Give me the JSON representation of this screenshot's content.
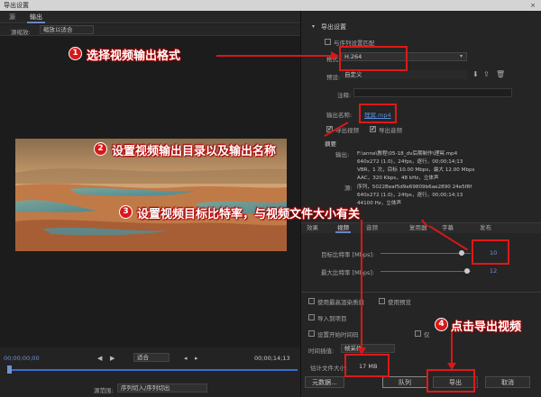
{
  "window": {
    "title": "导出设置",
    "close_glyph": "×"
  },
  "left": {
    "tabs": [
      "源",
      "输出"
    ],
    "source_scale_label": "源缩放:",
    "source_scale_value": "缩放以适合",
    "timecode_start": "00;00;00;00",
    "timecode_end": "00;00;14;13",
    "fit_value": "适合",
    "source_range_label": "源范围:",
    "source_range_value": "序列切入/序列切出"
  },
  "export": {
    "section_title": "导出设置",
    "match_sequence_label": "与序列设置匹配",
    "format_label": "格式:",
    "format_value": "H.264",
    "preset_label": "预设:",
    "preset_value": "自定义",
    "comment_label": "注释:",
    "output_name_label": "输出名称:",
    "output_name_value": "理冥.mp4",
    "export_video_label": "导出视频",
    "export_audio_label": "导出音频",
    "summary_title": "摘要",
    "output_key": "输出:",
    "output_lines": [
      "F:\\anne\\教程\\05-18_dv后期制作\\理冥.mp4",
      "640x272 (1.0)，24fps，逐行，00;00;14;13",
      "VBR，1 次，目标 10.00 Mbps，最大 12.00 Mbps",
      "AAC，320 Kbps，48 kHz，立体声"
    ],
    "source_key": "源:",
    "source_lines": [
      "序列，5022Beaf5d9e69809b6ae2890 24e5f8f",
      "640x272 (1.0)，24fps，逐行，00;00;14;13",
      "44100 Hz，立体声"
    ]
  },
  "tabs2": [
    "效果",
    "视频",
    "音频",
    "复用器",
    "字幕",
    "发布"
  ],
  "bitrate": {
    "target_label": "目标比特率 [Mbps]:",
    "target_value": "10",
    "target_fraction": 0.9,
    "max_label": "最大比特率 [Mbps]:",
    "max_value": "12",
    "max_fraction": 0.96
  },
  "options": {
    "max_render_quality": "使用最高渲染质量",
    "use_preview": "使用预览",
    "import_project": "导入到项目",
    "set_start_timecode": "设置开始时间码",
    "alpha_only": "仅",
    "time_interp_label": "时间插值:",
    "time_interp_value": "帧采样",
    "file_size_label": "估计文件大小:",
    "file_size_value": "17 MB"
  },
  "buttons": {
    "metadata": "元数据...",
    "queue": "队列",
    "export": "导出",
    "cancel": "取消"
  },
  "annotations": [
    {
      "num": "1",
      "text": "选择视频输出格式"
    },
    {
      "num": "2",
      "text": "设置视频输出目录以及输出名称"
    },
    {
      "num": "3",
      "text": "设置视频目标比特率，与视频文件大小有关"
    },
    {
      "num": "4",
      "text": "点击导出视频"
    }
  ],
  "colors": {
    "annotation_red": "#e01818",
    "link_blue": "#5a8fe0",
    "accent": "#6a86c8"
  }
}
